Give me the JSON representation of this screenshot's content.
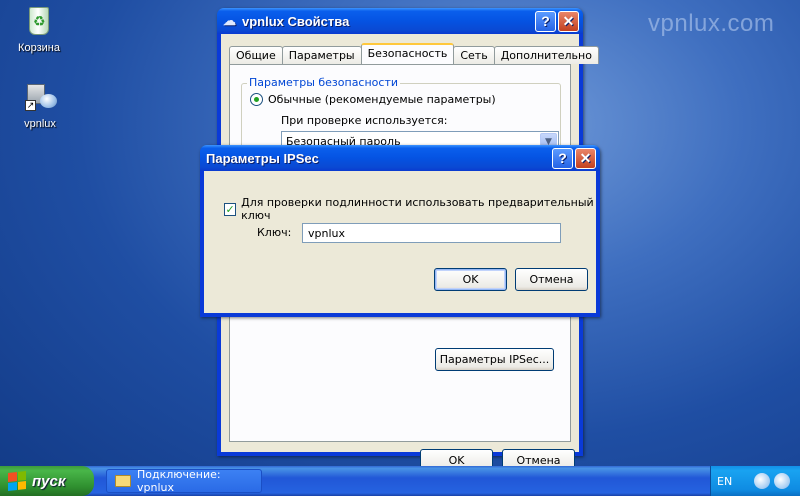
{
  "desktop": {
    "watermark": "vpnlux.com",
    "icons": [
      {
        "label": "Корзина"
      },
      {
        "label": "vpnlux"
      }
    ]
  },
  "props_window": {
    "title": "vpnlux Свойства",
    "help_label": "?",
    "close_label": "✕",
    "tabs": [
      {
        "label": "Общие"
      },
      {
        "label": "Параметры"
      },
      {
        "label": "Безопасность"
      },
      {
        "label": "Сеть"
      },
      {
        "label": "Дополнительно"
      }
    ],
    "active_tab": "Безопасность",
    "security_group": "Параметры безопасности",
    "radio_label": "Обычные (рекомендуемые параметры)",
    "verify_label": "При проверке используется:",
    "verify_value": "Безопасный пароль",
    "ipsec_button": "Параметры IPSec...",
    "ok_label": "OK",
    "cancel_label": "Отмена"
  },
  "ipsec_dialog": {
    "title": "Параметры IPSec",
    "help_label": "?",
    "close_label": "✕",
    "checkbox_label": "Для проверки подлинности использовать предварительный ключ",
    "checkbox_checked": true,
    "key_label": "Ключ:",
    "key_value": "vpnlux",
    "ok_label": "OK",
    "cancel_label": "Отмена"
  },
  "taskbar": {
    "start_label": "пуск",
    "task_label": "Подключение: vpnlux",
    "lang": "EN"
  }
}
